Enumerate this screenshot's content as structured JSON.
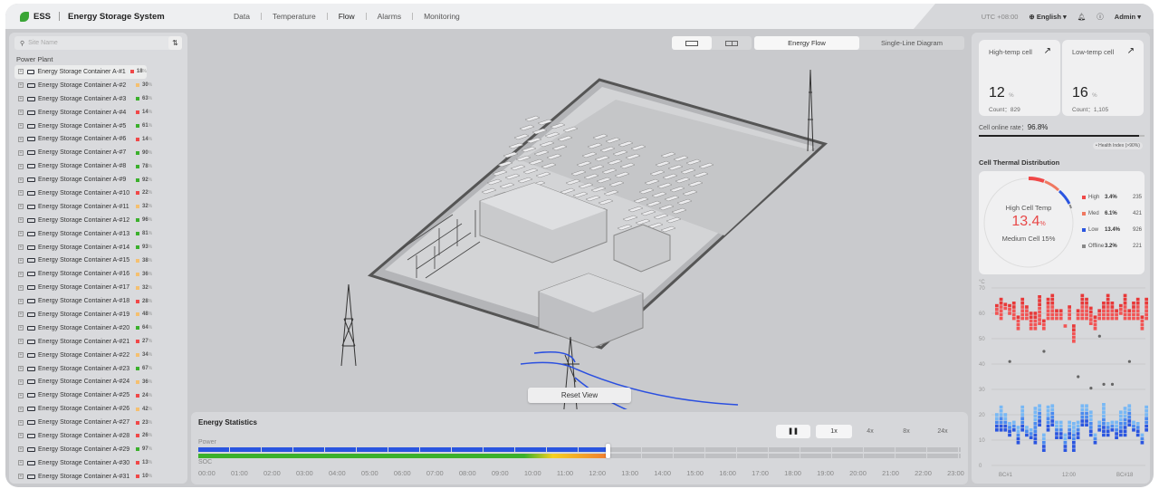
{
  "header": {
    "logo": "ESS",
    "title": "Energy Storage System",
    "nav": [
      "Data",
      "Temperature",
      "Flow",
      "Alarms",
      "Monitoring"
    ],
    "active_nav": "Flow",
    "timezone": "UTC +08:00",
    "language": "English",
    "user": "Admin"
  },
  "sidebar": {
    "search_placeholder": "Site Name",
    "group": "Power Plant",
    "items": [
      {
        "name": "Energy Storage Container A-#1",
        "pct": "18",
        "status": "red"
      },
      {
        "name": "Energy Storage Container A-#2",
        "pct": "30",
        "status": "orange"
      },
      {
        "name": "Energy Storage Container A-#3",
        "pct": "63",
        "status": "green"
      },
      {
        "name": "Energy Storage Container A-#4",
        "pct": "14",
        "status": "red"
      },
      {
        "name": "Energy Storage Container A-#5",
        "pct": "61",
        "status": "green"
      },
      {
        "name": "Energy Storage Container A-#6",
        "pct": "14",
        "status": "red"
      },
      {
        "name": "Energy Storage Container A-#7",
        "pct": "90",
        "status": "green"
      },
      {
        "name": "Energy Storage Container A-#8",
        "pct": "78",
        "status": "green"
      },
      {
        "name": "Energy Storage Container A-#9",
        "pct": "92",
        "status": "green"
      },
      {
        "name": "Energy Storage Container A-#10",
        "pct": "22",
        "status": "red"
      },
      {
        "name": "Energy Storage Container A-#11",
        "pct": "32",
        "status": "orange"
      },
      {
        "name": "Energy Storage Container A-#12",
        "pct": "96",
        "status": "green"
      },
      {
        "name": "Energy Storage Container A-#13",
        "pct": "81",
        "status": "green"
      },
      {
        "name": "Energy Storage Container A-#14",
        "pct": "93",
        "status": "green"
      },
      {
        "name": "Energy Storage Container A-#15",
        "pct": "38",
        "status": "orange"
      },
      {
        "name": "Energy Storage Container A-#16",
        "pct": "36",
        "status": "orange"
      },
      {
        "name": "Energy Storage Container A-#17",
        "pct": "32",
        "status": "orange"
      },
      {
        "name": "Energy Storage Container A-#18",
        "pct": "28",
        "status": "red"
      },
      {
        "name": "Energy Storage Container A-#19",
        "pct": "48",
        "status": "orange"
      },
      {
        "name": "Energy Storage Container A-#20",
        "pct": "64",
        "status": "green"
      },
      {
        "name": "Energy Storage Container A-#21",
        "pct": "27",
        "status": "red"
      },
      {
        "name": "Energy Storage Container A-#22",
        "pct": "34",
        "status": "orange"
      },
      {
        "name": "Energy Storage Container A-#23",
        "pct": "67",
        "status": "green"
      },
      {
        "name": "Energy Storage Container A-#24",
        "pct": "36",
        "status": "orange"
      },
      {
        "name": "Energy Storage Container A-#25",
        "pct": "24",
        "status": "red"
      },
      {
        "name": "Energy Storage Container A-#26",
        "pct": "42",
        "status": "orange"
      },
      {
        "name": "Energy Storage Container A-#27",
        "pct": "23",
        "status": "red"
      },
      {
        "name": "Energy Storage Container A-#28",
        "pct": "26",
        "status": "red"
      },
      {
        "name": "Energy Storage Container A-#29",
        "pct": "97",
        "status": "green"
      },
      {
        "name": "Energy Storage Container A-#30",
        "pct": "13",
        "status": "red"
      },
      {
        "name": "Energy Storage Container A-#31",
        "pct": "10",
        "status": "red"
      }
    ]
  },
  "colors": {
    "red": "#f04848",
    "orange": "#f5c070",
    "green": "#3bb02c",
    "blue": "#2a55e0",
    "accent": "#3aa536"
  },
  "scene": {
    "tabs": [
      "Energy Flow",
      "Single-Line Diagram"
    ],
    "active_tab": "Energy Flow",
    "reset_label": "Reset View"
  },
  "stats": {
    "title": "Energy Statistics",
    "power_label": "Power",
    "soc_label": "SOC",
    "times": [
      "00:00",
      "01:00",
      "02:00",
      "03:00",
      "04:00",
      "05:00",
      "06:00",
      "07:00",
      "08:00",
      "09:00",
      "10:00",
      "11:00",
      "12:00",
      "13:00",
      "14:00",
      "15:00",
      "16:00",
      "17:00",
      "18:00",
      "19:00",
      "20:00",
      "21:00",
      "22:00",
      "23:00"
    ],
    "progress": 0.535,
    "speeds": [
      "1x",
      "4x",
      "8x",
      "24x"
    ],
    "active_speed": "1x"
  },
  "right": {
    "high_card": {
      "title": "High-temp cell",
      "value": "12",
      "unit": "%",
      "count": "Count：829"
    },
    "low_card": {
      "title": "Low-temp cell",
      "value": "16",
      "unit": "%",
      "count": "Count：1,105"
    },
    "online_label": "Cell online rate：",
    "online_value": "96.8%",
    "online_rate": 0.968,
    "health_label": "• Health Index (>90%)",
    "dist_title": "Cell Thermal Distribution",
    "donut": {
      "title": "High Cell Temp",
      "value": "13.4",
      "unit": "%",
      "sub": "Medium Cell 15%"
    },
    "legend": [
      {
        "name": "High",
        "pct": "3.4%",
        "count": "235",
        "color": "#f04848"
      },
      {
        "name": "Med",
        "pct": "6.1%",
        "count": "421",
        "color": "#f07860"
      },
      {
        "name": "Low",
        "pct": "13.4%",
        "count": "926",
        "color": "#2a55e0"
      },
      {
        "name": "Offline",
        "pct": "3.2%",
        "count": "221",
        "color": "#888888"
      }
    ]
  },
  "chart_data": {
    "type": "scatter",
    "ylabel": "°C",
    "ylim": [
      0,
      70
    ],
    "yticks": [
      0,
      10,
      20,
      30,
      40,
      50,
      60,
      70
    ],
    "xticks": [
      "BC#1",
      "12:00",
      "BC#18"
    ],
    "high_ranges": [
      [
        60,
        64
      ],
      [
        58,
        66
      ],
      [
        62,
        64
      ],
      [
        60,
        63
      ],
      [
        58,
        64
      ],
      [
        54,
        59
      ],
      [
        58,
        66
      ],
      [
        58,
        63
      ],
      [
        54,
        61
      ],
      [
        54,
        60
      ],
      [
        56,
        67
      ],
      [
        54,
        58
      ],
      [
        58,
        66
      ],
      [
        58,
        67
      ],
      [
        58,
        61
      ],
      [
        58,
        61
      ],
      [
        55,
        56
      ],
      [
        58,
        63
      ],
      [
        49,
        56
      ],
      [
        58,
        61
      ],
      [
        58,
        67
      ],
      [
        58,
        66
      ],
      [
        56,
        63
      ],
      [
        54,
        59
      ],
      [
        58,
        61
      ],
      [
        58,
        64
      ],
      [
        58,
        67
      ],
      [
        58,
        64
      ],
      [
        58,
        61
      ],
      [
        60,
        64
      ],
      [
        58,
        67
      ],
      [
        58,
        61
      ],
      [
        58,
        64
      ],
      [
        58,
        66
      ],
      [
        54,
        59
      ],
      [
        58,
        66
      ]
    ],
    "low_ranges": [
      [
        14,
        21
      ],
      [
        14,
        23
      ],
      [
        14,
        21
      ],
      [
        12,
        17
      ],
      [
        14,
        18
      ],
      [
        9,
        15
      ],
      [
        14,
        23
      ],
      [
        12,
        15
      ],
      [
        11,
        14
      ],
      [
        9,
        23
      ],
      [
        16,
        24
      ],
      [
        6,
        13
      ],
      [
        14,
        23
      ],
      [
        16,
        24
      ],
      [
        11,
        18
      ],
      [
        11,
        18
      ],
      [
        6,
        13
      ],
      [
        11,
        18
      ],
      [
        6,
        17
      ],
      [
        11,
        18
      ],
      [
        16,
        24
      ],
      [
        16,
        24
      ],
      [
        12,
        21
      ],
      [
        9,
        13
      ],
      [
        14,
        18
      ],
      [
        12,
        24
      ],
      [
        12,
        17
      ],
      [
        14,
        17
      ],
      [
        11,
        17
      ],
      [
        12,
        21
      ],
      [
        12,
        23
      ],
      [
        16,
        24
      ],
      [
        14,
        18
      ],
      [
        12,
        17
      ],
      [
        9,
        13
      ],
      [
        14,
        23
      ]
    ],
    "outliers": [
      [
        3,
        41
      ],
      [
        11,
        45
      ],
      [
        19,
        35
      ],
      [
        22,
        30.5
      ],
      [
        24,
        51
      ],
      [
        25,
        32
      ],
      [
        27,
        32
      ],
      [
        31,
        41
      ]
    ]
  }
}
